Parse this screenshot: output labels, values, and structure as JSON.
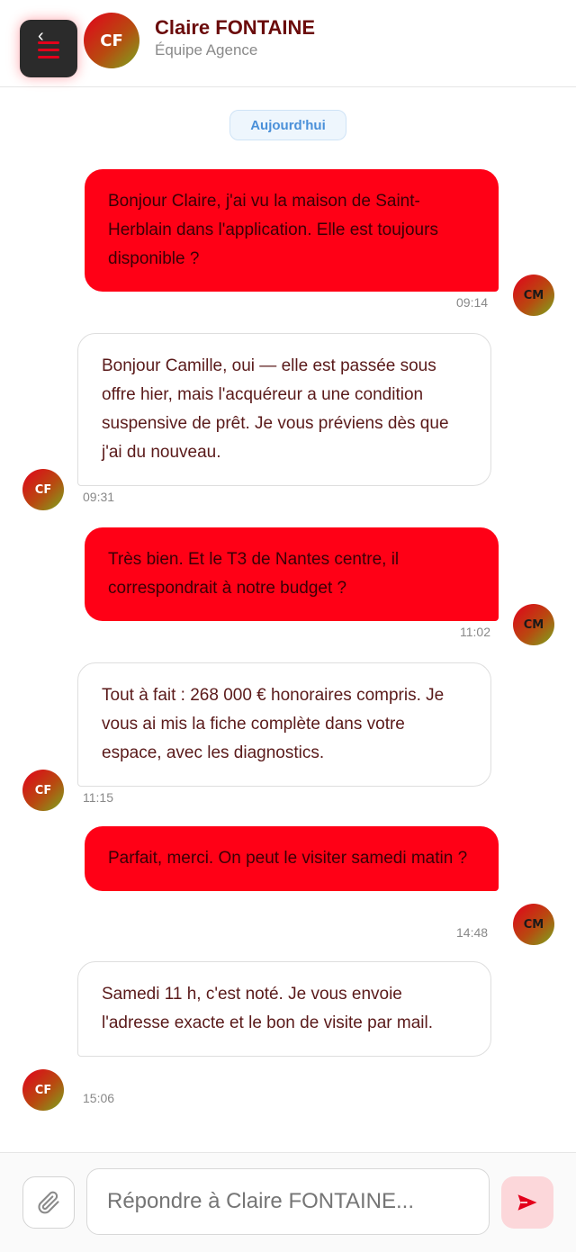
{
  "header": {
    "menu_icon": "hamburger-menu-icon",
    "back_icon": "back-arrow-icon",
    "contact_initials": "CF",
    "contact_name": "Claire FONTAINE",
    "contact_team": "Équipe Agence"
  },
  "conversation": {
    "day_label": "Aujourd'hui",
    "messages": [
      {
        "direction": "out",
        "author_initials": "CM",
        "text": "Bonjour Claire, j'ai vu la maison de Saint-Herblain dans l'application. Elle est toujours disponible ?",
        "time": "09:14"
      },
      {
        "direction": "in",
        "author_initials": "CF",
        "text": "Bonjour Camille, oui — elle est passée sous offre hier, mais l'acquéreur a une condition suspensive de prêt. Je vous préviens dès que j'ai du nouveau.",
        "time": "09:31"
      },
      {
        "direction": "out",
        "author_initials": "CM",
        "text": "Très bien. Et le T3 de Nantes centre, il correspondrait à notre budget ?",
        "time": "11:02"
      },
      {
        "direction": "in",
        "author_initials": "CF",
        "text": "Tout à fait : 268 000 € honoraires compris. Je vous ai mis la fiche complète dans votre espace, avec les diagnostics.",
        "time": "11:15"
      },
      {
        "direction": "out",
        "author_initials": "CM",
        "text": "Parfait, merci. On peut le visiter samedi matin ?",
        "time": "14:48"
      },
      {
        "direction": "in",
        "author_initials": "CF",
        "text": "Samedi 11 h, c'est noté. Je vous envoie l'adresse exacte et le bon de visite par mail.",
        "time": "15:06"
      }
    ]
  },
  "composer": {
    "attach_icon": "paperclip-icon",
    "placeholder": "Répondre à Claire FONTAINE...",
    "send_icon": "send-arrow-icon"
  },
  "colors": {
    "accent": "#ff0016",
    "brand_dark": "#6b0c0c",
    "day_pill_text": "#4a90d9",
    "send_bg": "#fcd7da"
  }
}
